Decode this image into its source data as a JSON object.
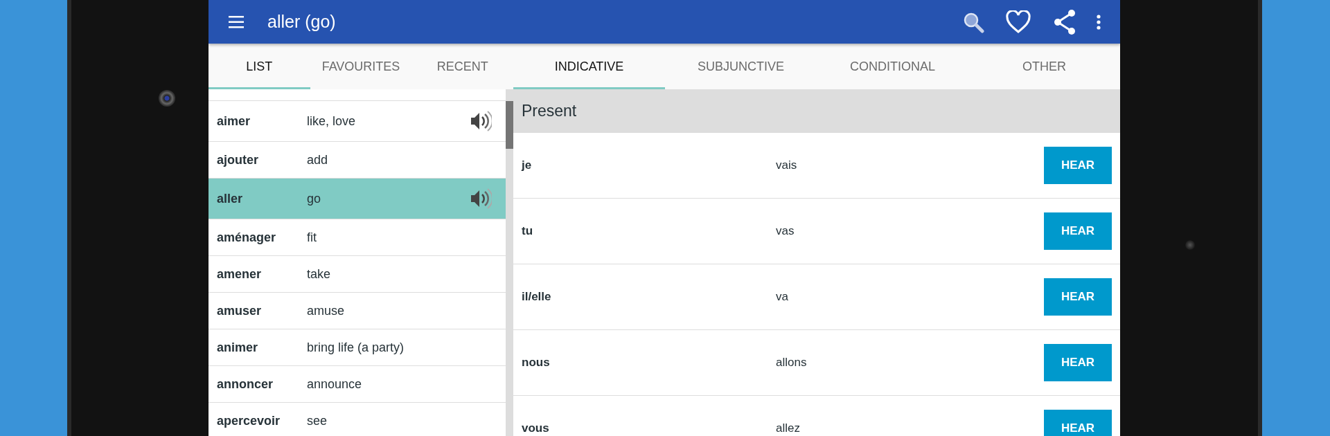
{
  "app_bar": {
    "title": "aller (go)"
  },
  "list_tabs": [
    {
      "label": "LIST",
      "selected": true
    },
    {
      "label": "FAVOURITES",
      "selected": false
    },
    {
      "label": "RECENT",
      "selected": false
    }
  ],
  "mood_tabs": [
    {
      "label": "INDICATIVE",
      "selected": true
    },
    {
      "label": "SUBJUNCTIVE",
      "selected": false
    },
    {
      "label": "CONDITIONAL",
      "selected": false
    },
    {
      "label": "OTHER",
      "selected": false
    }
  ],
  "verbs": [
    {
      "verb": "aimer",
      "meaning": "like, love",
      "audio": true,
      "selected": false
    },
    {
      "verb": "ajouter",
      "meaning": "add",
      "audio": false,
      "selected": false
    },
    {
      "verb": "aller",
      "meaning": "go",
      "audio": true,
      "selected": true
    },
    {
      "verb": "aménager",
      "meaning": "fit",
      "audio": false,
      "selected": false
    },
    {
      "verb": "amener",
      "meaning": "take",
      "audio": false,
      "selected": false
    },
    {
      "verb": "amuser",
      "meaning": "amuse",
      "audio": false,
      "selected": false
    },
    {
      "verb": "animer",
      "meaning": "bring life (a party)",
      "audio": false,
      "selected": false
    },
    {
      "verb": "annoncer",
      "meaning": "announce",
      "audio": false,
      "selected": false
    },
    {
      "verb": "apercevoir",
      "meaning": "see",
      "audio": false,
      "selected": false
    }
  ],
  "tense": {
    "title": "Present",
    "rows": [
      {
        "pronoun": "je",
        "form": "vais",
        "button": "HEAR"
      },
      {
        "pronoun": "tu",
        "form": "vas",
        "button": "HEAR"
      },
      {
        "pronoun": "il/elle",
        "form": "va",
        "button": "HEAR"
      },
      {
        "pronoun": "nous",
        "form": "allons",
        "button": "HEAR"
      },
      {
        "pronoun": "vous",
        "form": "allez",
        "button": "HEAR"
      }
    ]
  }
}
